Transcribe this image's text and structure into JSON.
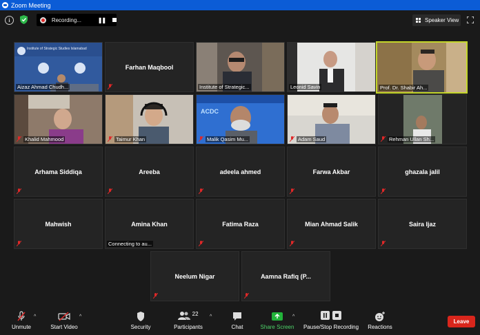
{
  "window": {
    "title": "Zoom Meeting"
  },
  "topbar": {
    "recording_label": "Recording...",
    "speaker_view_label": "Speaker View"
  },
  "tiles": [
    {
      "name": "Aizaz Ahmad Chudh...",
      "type": "video",
      "logo_text": "Institute of Strategic Studies Islamabad"
    },
    {
      "name": "Farhan Maqbool",
      "type": "name"
    },
    {
      "name": "Institute of Strategic...",
      "type": "video"
    },
    {
      "name": "Leonid Savin",
      "type": "video"
    },
    {
      "name": "Prof. Dr. Shabir Ah...",
      "type": "video",
      "active": true
    },
    {
      "name": "Khalid Mahmood",
      "type": "video"
    },
    {
      "name": "Taimur Khan",
      "type": "video"
    },
    {
      "name": "Malik Qasim Mu...",
      "type": "video",
      "logo_text": "ACDC"
    },
    {
      "name": "Adam Saud",
      "type": "video"
    },
    {
      "name": "Rehman Ullan Sh...",
      "type": "video"
    },
    {
      "name": "Arhama Siddiqa",
      "type": "name"
    },
    {
      "name": "Areeba",
      "type": "name"
    },
    {
      "name": "adeela ahmed",
      "type": "name"
    },
    {
      "name": "Farwa Akbar",
      "type": "name"
    },
    {
      "name": "ghazala jalil",
      "type": "name"
    },
    {
      "name": "Mahwish",
      "type": "name"
    },
    {
      "name": "Amina Khan",
      "type": "name",
      "status": "Connecting to au..."
    },
    {
      "name": "Fatima Raza",
      "type": "name"
    },
    {
      "name": "Mian Ahmad Salik",
      "type": "name"
    },
    {
      "name": "Saira Ijaz",
      "type": "name"
    },
    {
      "name": "Neelum Nigar",
      "type": "name"
    },
    {
      "name": "Aamna Rafiq (P...",
      "type": "name"
    }
  ],
  "toolbar": {
    "unmute": "Unmute",
    "start_video": "Start Video",
    "security": "Security",
    "participants": "Participants",
    "participants_count": "22",
    "chat": "Chat",
    "share_screen": "Share Screen",
    "recording": "Pause/Stop Recording",
    "reactions": "Reactions",
    "leave": "Leave"
  },
  "colors": {
    "titlebar": "#0b5cd6",
    "active_speaker_border": "#c4d62a",
    "share_green": "#22b33a",
    "leave_red": "#d9261c",
    "mute_red": "#e02828"
  }
}
